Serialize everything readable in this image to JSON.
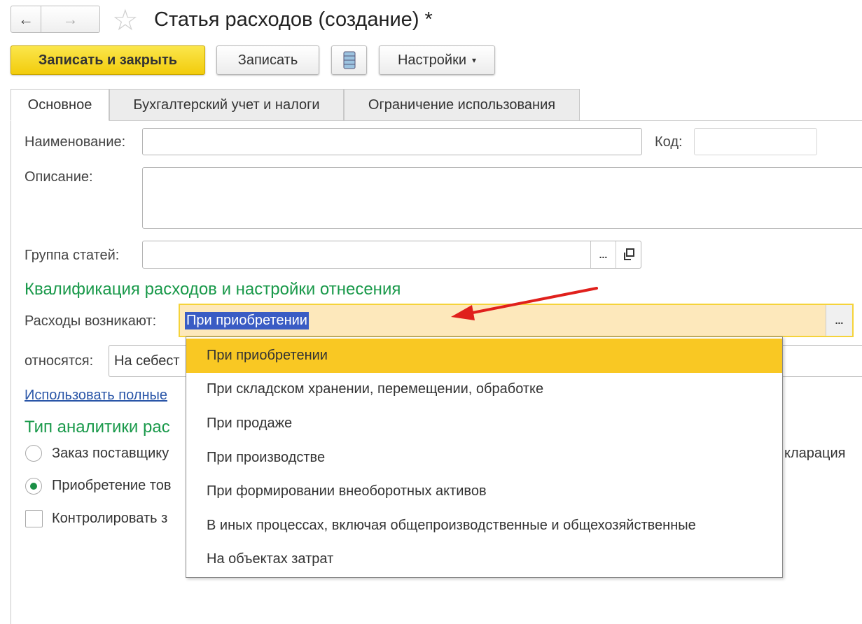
{
  "header": {
    "title": "Статья расходов (создание) *",
    "back_icon": "arrow-left-icon",
    "forward_icon": "arrow-right-icon",
    "favorite_icon": "star-icon"
  },
  "toolbar": {
    "save_close": "Записать и закрыть",
    "save": "Записать",
    "settings": "Настройки",
    "settings_arrow": "▾"
  },
  "tabs": [
    {
      "label": "Основное"
    },
    {
      "label": "Бухгалтерский учет и налоги"
    },
    {
      "label": "Ограничение использования"
    }
  ],
  "form": {
    "name_label": "Наименование:",
    "name_value": "",
    "code_label": "Код:",
    "code_value": "",
    "description_label": "Описание:",
    "description_value": "",
    "group_label": "Группа статей:",
    "group_value": "",
    "ellipsis": "...",
    "section1": "Квалификация расходов и настройки отнесения",
    "arise_label": "Расходы возникают:",
    "arise_value": "При приобретении",
    "relate_label": "относятся:",
    "relate_value": "На себест",
    "link": "Использовать полные",
    "section2": "Тип аналитики рас",
    "radio1": "Заказ поставщику",
    "radio2": "Приобретение тов",
    "checkbox": "Контролировать з",
    "right_fragment": "кларация"
  },
  "dropdown": {
    "selected_index": 0,
    "items": [
      "При приобретении",
      "При складском хранении, перемещении, обработке",
      "При продаже",
      "При производстве",
      "При формировании внеоборотных активов",
      "В иных процессах, включая общепроизводственные и общехозяйственные",
      "На объектах затрат"
    ]
  },
  "colors": {
    "accent_yellow": "#f9c823",
    "field_bg": "#fde8bb",
    "green": "#19994a",
    "link": "#2a56a8",
    "arrow": "#e0201c",
    "selection": "#3a5cc4"
  }
}
